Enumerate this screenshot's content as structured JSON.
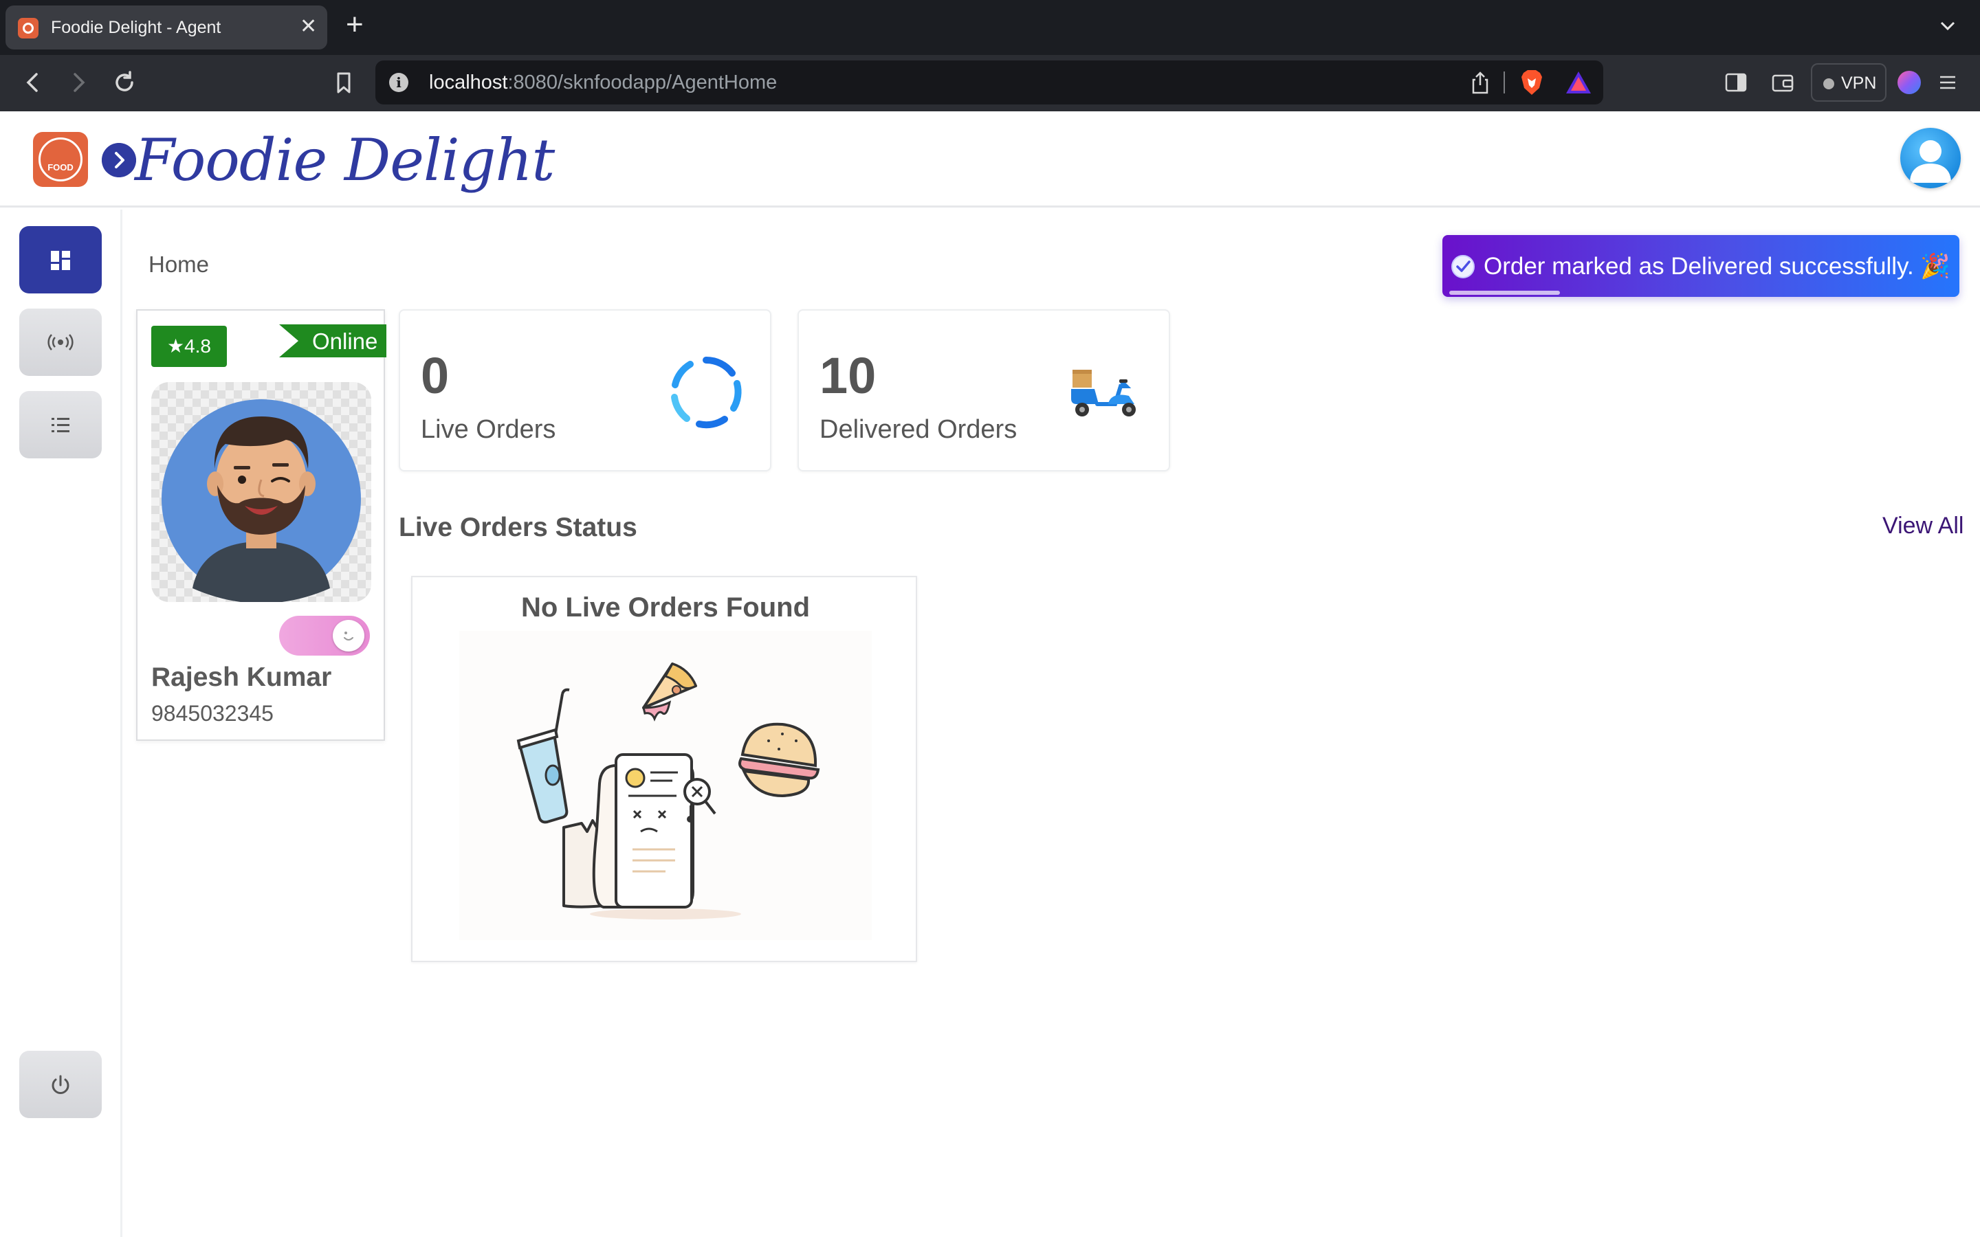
{
  "browser": {
    "tab_title": "Foodie Delight - Agent",
    "tab_close": "✕",
    "new_tab": "+",
    "url_host": "localhost",
    "url_path": ":8080/sknfoodapp/AgentHome",
    "vpn_label": "VPN"
  },
  "app": {
    "logo_text": "FOOD",
    "brand_title": "Foodie Delight",
    "breadcrumb": "Home",
    "toast": {
      "message": "Order marked as Delivered successfully. 🎉",
      "progress": 0.22
    },
    "sidebar": {
      "items": [
        {
          "name": "dashboard",
          "icon": "dashboard-grid-icon",
          "active": true
        },
        {
          "name": "live-orders",
          "icon": "broadcast-icon",
          "active": false
        },
        {
          "name": "order-list",
          "icon": "list-icon",
          "active": false
        }
      ],
      "logout_icon": "power-icon"
    },
    "agent": {
      "rating": "4.8",
      "status": "Online",
      "available": true,
      "name": "Rajesh Kumar",
      "phone": "9845032345"
    },
    "stats": [
      {
        "value": "0",
        "label": "Live Orders",
        "icon": "loading-spinner-icon"
      },
      {
        "value": "10",
        "label": "Delivered Orders",
        "icon": "scooter-icon"
      }
    ],
    "live_orders": {
      "title": "Live Orders Status",
      "view_all": "View All",
      "empty_message": "No Live Orders Found"
    }
  },
  "colors": {
    "primary": "#2f3aa0",
    "online_green": "#1f8a1f",
    "toast_start": "#6a11cb",
    "toast_end": "#2575fc",
    "view_all": "#3b1575"
  }
}
